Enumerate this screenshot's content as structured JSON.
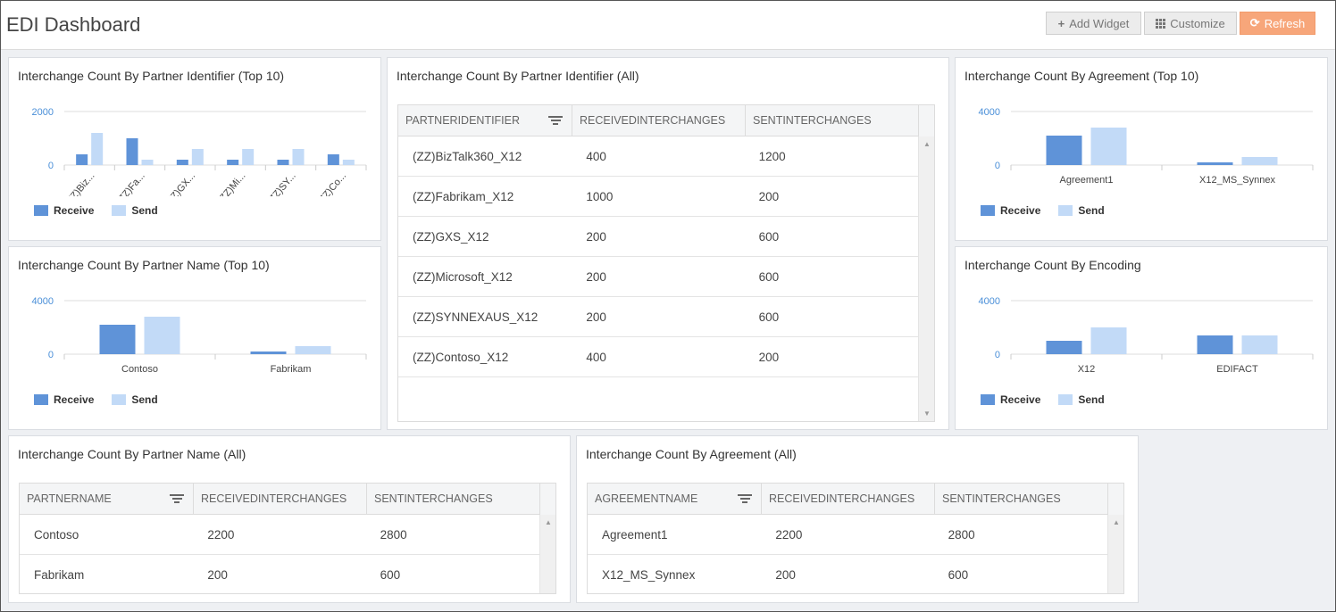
{
  "header": {
    "title": "EDI Dashboard",
    "add_widget": "Add Widget",
    "customize": "Customize",
    "refresh": "Refresh"
  },
  "colors": {
    "receive": "#5f93d8",
    "send": "#c2daf7",
    "refresh": "#f7a67a"
  },
  "legend": {
    "receive": "Receive",
    "send": "Send"
  },
  "widgets": {
    "partner_id_top10": {
      "title": "Interchange Count By Partner Identifier (Top 10)"
    },
    "partner_id_all": {
      "title": "Interchange Count By Partner Identifier (All)"
    },
    "agreement_top10": {
      "title": "Interchange Count By Agreement (Top 10)"
    },
    "partner_name_top10": {
      "title": "Interchange Count By Partner Name (Top 10)"
    },
    "encoding": {
      "title": "Interchange Count By Encoding"
    },
    "partner_name_all": {
      "title": "Interchange Count By Partner Name (All)"
    },
    "agreement_all": {
      "title": "Interchange Count By Agreement (All)"
    }
  },
  "tables": {
    "partner_id_all": {
      "headers": [
        "PARTNERIDENTIFIER",
        "RECEIVEDINTERCHANGES",
        "SENTINTERCHANGES"
      ],
      "rows": [
        [
          "(ZZ)BizTalk360_X12",
          "400",
          "1200"
        ],
        [
          "(ZZ)Fabrikam_X12",
          "1000",
          "200"
        ],
        [
          "(ZZ)GXS_X12",
          "200",
          "600"
        ],
        [
          "(ZZ)Microsoft_X12",
          "200",
          "600"
        ],
        [
          "(ZZ)SYNNEXAUS_X12",
          "200",
          "600"
        ],
        [
          "(ZZ)Contoso_X12",
          "400",
          "200"
        ]
      ]
    },
    "partner_name_all": {
      "headers": [
        "PARTNERNAME",
        "RECEIVEDINTERCHANGES",
        "SENTINTERCHANGES"
      ],
      "rows": [
        [
          "Contoso",
          "2200",
          "2800"
        ],
        [
          "Fabrikam",
          "200",
          "600"
        ]
      ]
    },
    "agreement_all": {
      "headers": [
        "AGREEMENTNAME",
        "RECEIVEDINTERCHANGES",
        "SENTINTERCHANGES"
      ],
      "rows": [
        [
          "Agreement1",
          "2200",
          "2800"
        ],
        [
          "X12_MS_Synnex",
          "200",
          "600"
        ]
      ]
    }
  },
  "chart_data": [
    {
      "id": "partner_id_top10",
      "type": "bar",
      "categories": [
        "(ZZ)Biz...",
        "(ZZ)Fa...",
        "(ZZ)GX...",
        "(ZZ)Mi...",
        "(ZZ)SY...",
        "(ZZ)Co..."
      ],
      "series": [
        {
          "name": "Receive",
          "values": [
            400,
            1000,
            200,
            200,
            200,
            400
          ]
        },
        {
          "name": "Send",
          "values": [
            1200,
            200,
            600,
            600,
            600,
            200
          ]
        }
      ],
      "yticks": [
        0,
        2000
      ],
      "ylim": [
        0,
        2000
      ],
      "rotated_labels": true
    },
    {
      "id": "agreement_top10",
      "type": "bar",
      "categories": [
        "Agreement1",
        "X12_MS_Synnex"
      ],
      "series": [
        {
          "name": "Receive",
          "values": [
            2200,
            200
          ]
        },
        {
          "name": "Send",
          "values": [
            2800,
            600
          ]
        }
      ],
      "yticks": [
        0,
        4000
      ],
      "ylim": [
        0,
        4000
      ]
    },
    {
      "id": "partner_name_top10",
      "type": "bar",
      "categories": [
        "Contoso",
        "Fabrikam"
      ],
      "series": [
        {
          "name": "Receive",
          "values": [
            2200,
            200
          ]
        },
        {
          "name": "Send",
          "values": [
            2800,
            600
          ]
        }
      ],
      "yticks": [
        0,
        4000
      ],
      "ylim": [
        0,
        4000
      ]
    },
    {
      "id": "encoding",
      "type": "bar",
      "categories": [
        "X12",
        "EDIFACT"
      ],
      "series": [
        {
          "name": "Receive",
          "values": [
            1000,
            1400
          ]
        },
        {
          "name": "Send",
          "values": [
            2000,
            1400
          ]
        }
      ],
      "yticks": [
        0,
        4000
      ],
      "ylim": [
        0,
        4000
      ]
    }
  ]
}
